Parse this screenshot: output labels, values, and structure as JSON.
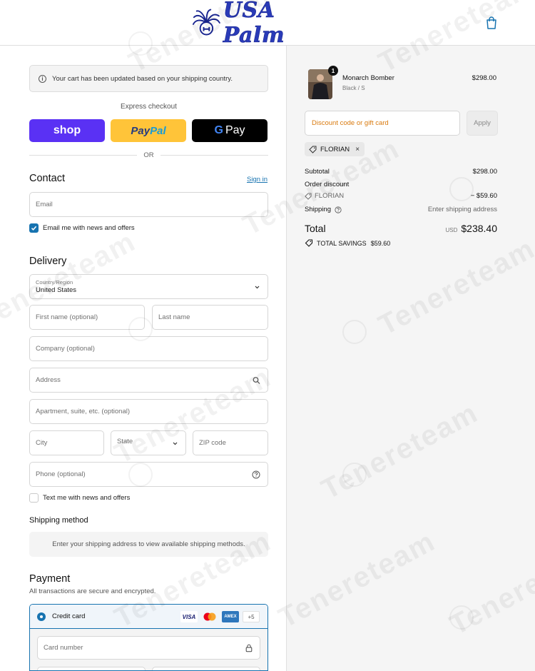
{
  "header": {
    "logo_text": "USA Palm",
    "cart_icon": "shopping-bag-icon"
  },
  "notice": {
    "text": "Your cart has been updated based on your shipping country."
  },
  "express": {
    "label": "Express checkout",
    "shop_label": "shop",
    "paypal_part1": "Pay",
    "paypal_part2": "Pal",
    "gpay_g": "G",
    "gpay_label": "Pay",
    "or_label": "OR"
  },
  "contact": {
    "title": "Contact",
    "sign_in": "Sign in",
    "email_placeholder": "Email",
    "newsletter_label": "Email me with news and offers",
    "newsletter_checked": true
  },
  "delivery": {
    "title": "Delivery",
    "country_label": "Country/Region",
    "country_value": "United States",
    "first_name_placeholder": "First name (optional)",
    "last_name_placeholder": "Last name",
    "company_placeholder": "Company (optional)",
    "address_placeholder": "Address",
    "apartment_placeholder": "Apartment, suite, etc. (optional)",
    "city_placeholder": "City",
    "state_placeholder": "State",
    "zip_placeholder": "ZIP code",
    "phone_placeholder": "Phone (optional)",
    "sms_label": "Text me with news and offers",
    "sms_checked": false
  },
  "shipping_method": {
    "title": "Shipping method",
    "message": "Enter your shipping address to view available shipping methods."
  },
  "payment": {
    "title": "Payment",
    "subtitle": "All transactions are secure and encrypted.",
    "method_label": "Credit card",
    "card_brands": [
      "VISA",
      "AMEX"
    ],
    "more_cards": "+5",
    "card_number_placeholder": "Card number"
  },
  "summary": {
    "product": {
      "name": "Monarch Bomber",
      "variant": "Black / S",
      "price": "$298.00",
      "quantity": "1"
    },
    "discount_placeholder": "Discount code or gift card",
    "apply_label": "Apply",
    "applied_code": "FLORIAN",
    "remove_symbol": "×",
    "subtotal_label": "Subtotal",
    "subtotal_value": "$298.00",
    "order_discount_label": "Order discount",
    "discount_code_line": "FLORIAN",
    "discount_value": "− $59.60",
    "shipping_label": "Shipping",
    "shipping_value": "Enter shipping address",
    "total_label": "Total",
    "currency": "USD",
    "total_value": "$238.40",
    "savings_label": "TOTAL SAVINGS",
    "savings_value": "$59.60"
  },
  "watermark": "Tenereteam",
  "colors": {
    "accent": "#1773b0",
    "shop_pay": "#5a31f4",
    "paypal": "#ffc439",
    "gpay": "#000000",
    "logo": "#2a3bb8",
    "discount_placeholder": "#d97a0e"
  }
}
